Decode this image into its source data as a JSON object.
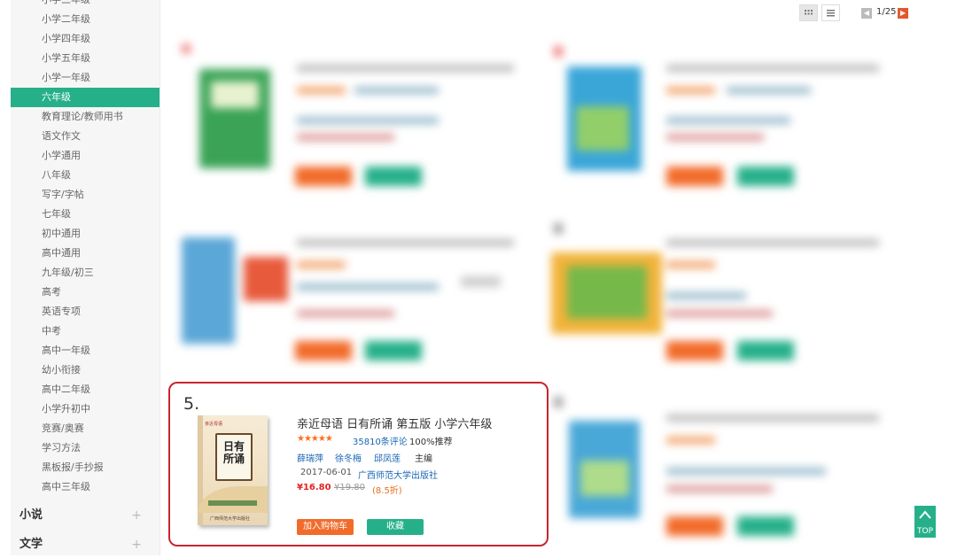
{
  "sidebar": {
    "items": [
      {
        "label": "小学三年级",
        "active": false
      },
      {
        "label": "小学二年级",
        "active": false
      },
      {
        "label": "小学四年级",
        "active": false
      },
      {
        "label": "小学五年级",
        "active": false
      },
      {
        "label": "小学一年级",
        "active": false
      },
      {
        "label": "六年级",
        "active": true
      },
      {
        "label": "教育理论/教师用书",
        "active": false
      },
      {
        "label": "语文作文",
        "active": false
      },
      {
        "label": "小学通用",
        "active": false
      },
      {
        "label": "八年级",
        "active": false
      },
      {
        "label": "写字/字帖",
        "active": false
      },
      {
        "label": "七年级",
        "active": false
      },
      {
        "label": "初中通用",
        "active": false
      },
      {
        "label": "高中通用",
        "active": false
      },
      {
        "label": "九年级/初三",
        "active": false
      },
      {
        "label": "高考",
        "active": false
      },
      {
        "label": "英语专项",
        "active": false
      },
      {
        "label": "中考",
        "active": false
      },
      {
        "label": "高中一年级",
        "active": false
      },
      {
        "label": "幼小衔接",
        "active": false
      },
      {
        "label": "高中二年级",
        "active": false
      },
      {
        "label": "小学升初中",
        "active": false
      },
      {
        "label": "竞赛/奥赛",
        "active": false
      },
      {
        "label": "学习方法",
        "active": false
      },
      {
        "label": "黑板报/手抄报",
        "active": false
      },
      {
        "label": "高中三年级",
        "active": false
      }
    ],
    "categories": [
      {
        "label": "小说",
        "expand": "+"
      },
      {
        "label": "文学",
        "expand": "+"
      }
    ]
  },
  "toolbar": {
    "pagination": "1/25",
    "grid_view_icon": "grid-icon",
    "list_view_icon": "list-icon"
  },
  "featured": {
    "number": "5.",
    "cover": {
      "brand": "亲近母语",
      "title_lines": [
        "日有",
        "所诵"
      ],
      "footer": "广西师范大学出版社"
    },
    "title": "亲近母语 日有所诵 第五版 小学六年级",
    "rating_stars": "★★★★★",
    "rating": 5,
    "comments": "35810条评论",
    "recommend": "100%推荐",
    "authors": [
      "薛瑞萍",
      "徐冬梅",
      "邱凤莲"
    ],
    "author_role": "主编",
    "date": "2017-06-01",
    "publisher": "广西师范大学出版社",
    "price": "¥16.80",
    "original_price": "¥19.80",
    "discount": "(8.5折)",
    "cart_label": "加入购物车",
    "fav_label": "收藏"
  },
  "top_button": {
    "label": "TOP",
    "icon": "chevron-up-icon"
  },
  "colors": {
    "accent_green": "#26b08a",
    "accent_orange": "#f26b2a",
    "highlight_red": "#c8252d",
    "link_blue": "#1a66b3",
    "price_red": "#e52222"
  }
}
